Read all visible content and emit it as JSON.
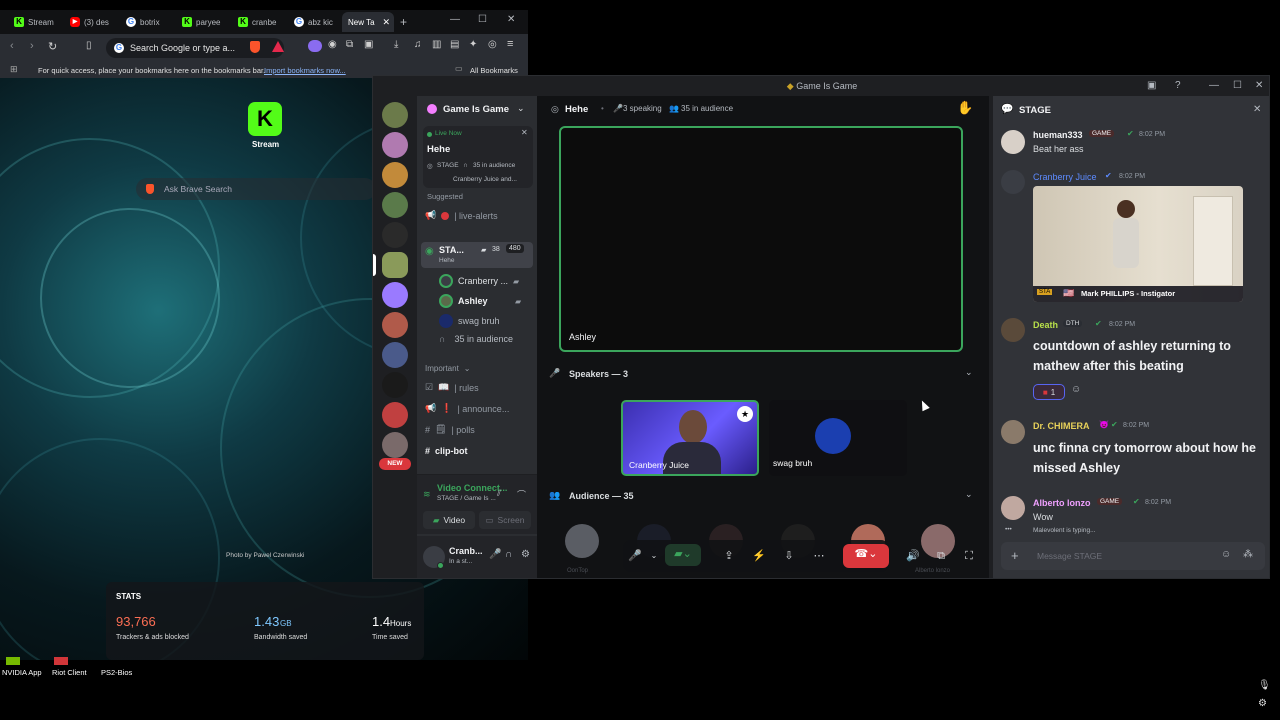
{
  "browser": {
    "tabs": [
      {
        "label": "Stream",
        "icon": "kick-icon",
        "color": "#53fc18"
      },
      {
        "label": "(3) des",
        "icon": "youtube-icon",
        "color": "#ff0000"
      },
      {
        "label": "botrix",
        "icon": "google-icon",
        "color": "#ffffff"
      },
      {
        "label": "paryee",
        "icon": "kick-icon",
        "color": "#53fc18"
      },
      {
        "label": "cranbe",
        "icon": "kick-icon",
        "color": "#53fc18"
      },
      {
        "label": "abz kic",
        "icon": "google-icon",
        "color": "#ffffff"
      },
      {
        "label": "New Ta",
        "icon": "",
        "color": "#ffffff"
      }
    ],
    "omnibox_text": "Search Google or type a...",
    "bookmarks_hint": "For quick access, place your bookmarks here on the bookmarks bar.",
    "bookmarks_import": "Import bookmarks now...",
    "all_bookmarks": "All Bookmarks",
    "shortcut_label": "Stream",
    "ask_placeholder": "Ask Brave Search",
    "photo_credit": "Photo by Pawel Czerwinski",
    "stats": {
      "title": "STATS",
      "blocked_value": "93,766",
      "blocked_label": "Trackers & ads blocked",
      "bandwidth_value": "1.43",
      "bandwidth_unit": "GB",
      "bandwidth_label": "Bandwidth saved",
      "time_value": "1.4",
      "time_unit": "Hours",
      "time_label": "Time saved"
    }
  },
  "taskbar": {
    "items": [
      "NVIDIA App",
      "Riot Client",
      "PS2-Bios"
    ]
  },
  "discord": {
    "window_title": "Game Is Game",
    "server_name": "Game Is Game",
    "live_now": "Live Now",
    "stage_topic": "Hehe",
    "stage_info": "STAGE",
    "stage_audience": "35 in audience",
    "stage_participants": "Cranberry Juice and...",
    "suggested": "Suggested",
    "channels": {
      "live_alerts": "| live-alerts",
      "stage_name": "STA...",
      "stage_count_a": "38",
      "stage_count_b": "480",
      "stage_sub": "Hehe",
      "member_1": "Cranberry ...",
      "member_2": "Ashley",
      "member_3": "swag bruh",
      "audience": "35 in audience",
      "category_important": "Important",
      "rules": "| rules",
      "announce": "| announce...",
      "polls": "| polls",
      "clip_bot": "clip-bot"
    },
    "new_badge": "NEW",
    "voice": {
      "status": "Video Connect...",
      "sub": "STAGE / Game Is ...",
      "video_btn": "Video",
      "screen_btn": "Screen"
    },
    "user": {
      "name": "Cranb...",
      "status": "In a st..."
    },
    "stage": {
      "header_title": "Hehe",
      "speaking": "3 speaking",
      "audience": "35 in audience",
      "main_video_name": "Ashley",
      "speakers_header": "Speakers — 3",
      "speaker_1": "Cranberry Juice",
      "speaker_2": "swag bruh",
      "audience_header": "Audience — 35",
      "audience_name_1": "OonTop",
      "audience_name_2": "Alberto lonzo"
    },
    "chat": {
      "header": "STAGE",
      "messages": [
        {
          "author": "hueman333",
          "tag": "GAME",
          "time": "8:02 PM",
          "text": "Beat her ass",
          "color": "#f2f3f5"
        },
        {
          "author": "Cranberry Juice",
          "tag": "",
          "time": "8:02 PM",
          "text": "",
          "color": "#5d8bff"
        },
        {
          "author": "Death",
          "tag": "DTH",
          "time": "8:02 PM",
          "text": "countdown of ashley returning to mathew after this beating",
          "color": "#b8e04a"
        },
        {
          "author": "Dr. CHIMERA",
          "tag": "",
          "time": "8:02 PM",
          "text": "unc finna cry tomorrow about how he missed Ashley",
          "color": "#e8d25a"
        },
        {
          "author": "Alberto lonzo",
          "tag": "GAME",
          "time": "8:02 PM",
          "text": "Wow",
          "color": "#f0a0ff"
        }
      ],
      "embed_caption": "Mark PHILLIPS - Instigator",
      "embed_badge": "STA",
      "reaction_count": "1",
      "typing": "Malevolent is typing...",
      "input_placeholder": "Message STAGE"
    }
  },
  "colors": {
    "kick_green": "#53fc18",
    "discord_blurple": "#5865f2",
    "online_green": "#3ba55c",
    "danger_red": "#da373c"
  }
}
